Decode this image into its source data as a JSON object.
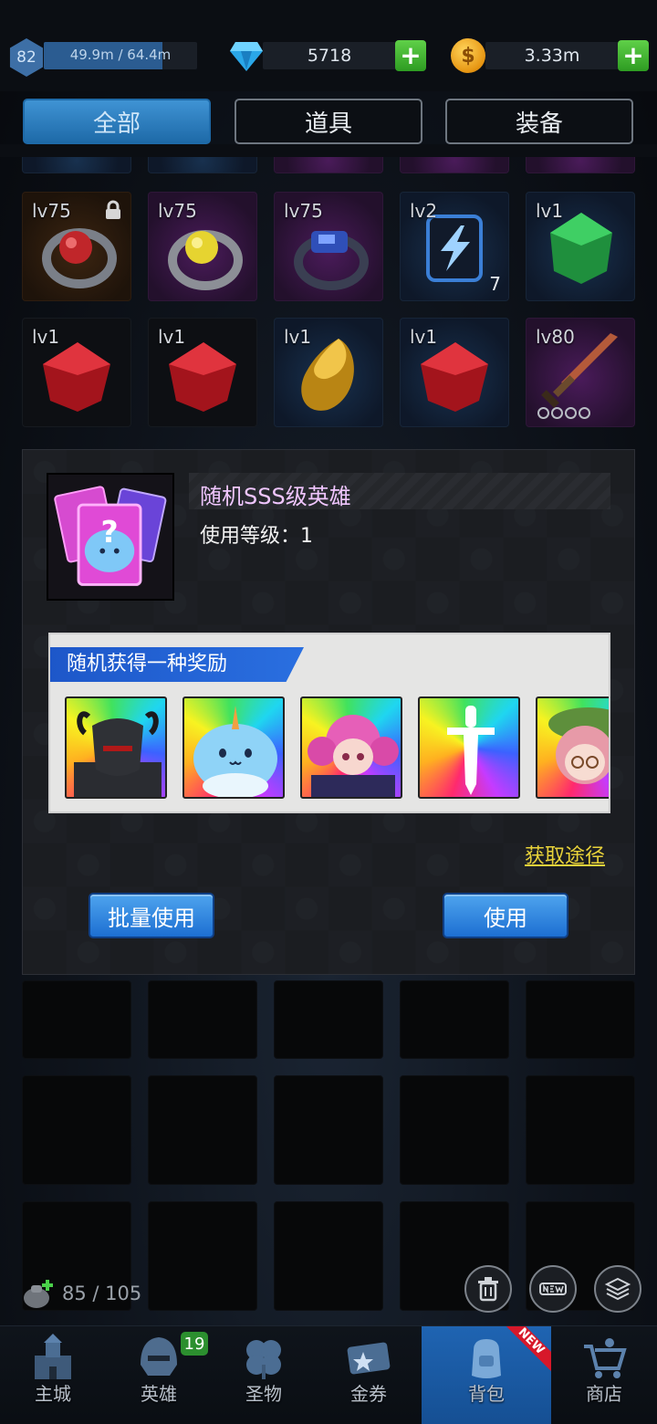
{
  "player": {
    "level": "82",
    "xp_text": "49.9m / 64.4m",
    "xp_fraction": 0.775
  },
  "resources": {
    "gems": "5718",
    "gold": "3.33m",
    "gold_symbol": "$"
  },
  "plus_label": "+",
  "tabs": [
    {
      "label": "全部",
      "active": true
    },
    {
      "label": "道具",
      "active": false
    },
    {
      "label": "装备",
      "active": false
    }
  ],
  "inventory_row1": [
    {
      "level": "lv75",
      "icon": "ring-red-icon",
      "locked": true
    },
    {
      "level": "lv75",
      "icon": "ring-yellow-icon"
    },
    {
      "level": "lv75",
      "icon": "ring-blue-icon"
    },
    {
      "level": "lv2",
      "icon": "lightning-scroll-icon",
      "count": "7"
    },
    {
      "level": "lv1",
      "icon": "green-gem-icon"
    }
  ],
  "inventory_row2": [
    {
      "level": "lv1",
      "icon": "red-gem-icon"
    },
    {
      "level": "lv1",
      "icon": "red-gem-icon"
    },
    {
      "level": "lv1",
      "icon": "amber-gem-icon"
    },
    {
      "level": "lv1",
      "icon": "red-gem-icon"
    },
    {
      "level": "lv80",
      "icon": "sword-icon"
    }
  ],
  "item_detail": {
    "name": "随机SSS级英雄",
    "use_level": "使用等级：1",
    "reward_title": "随机获得一种奖励",
    "rewards": [
      "dark-knight-hero-icon",
      "narwhal-hero-icon",
      "pink-girl-hero-icon",
      "sword-hero-icon",
      "elf-girl-hero-icon"
    ],
    "get_route": "获取途径",
    "batch_use": "批量使用",
    "use": "使用"
  },
  "bag": {
    "capacity": "85 / 105"
  },
  "navbar": [
    {
      "label": "主城",
      "icon": "castle-icon"
    },
    {
      "label": "英雄",
      "icon": "helmet-icon",
      "badge": "19"
    },
    {
      "label": "圣物",
      "icon": "clover-icon"
    },
    {
      "label": "金券",
      "icon": "ticket-icon"
    },
    {
      "label": "背包",
      "icon": "backpack-icon",
      "active": true,
      "ribbon": "NEW"
    },
    {
      "label": "商店",
      "icon": "cart-icon"
    }
  ],
  "colors": {
    "accent_blue": "#1e6aa8",
    "plus_green": "#3aa82c",
    "link_yellow": "#e8d23a",
    "item_name": "#f0c6ff"
  }
}
